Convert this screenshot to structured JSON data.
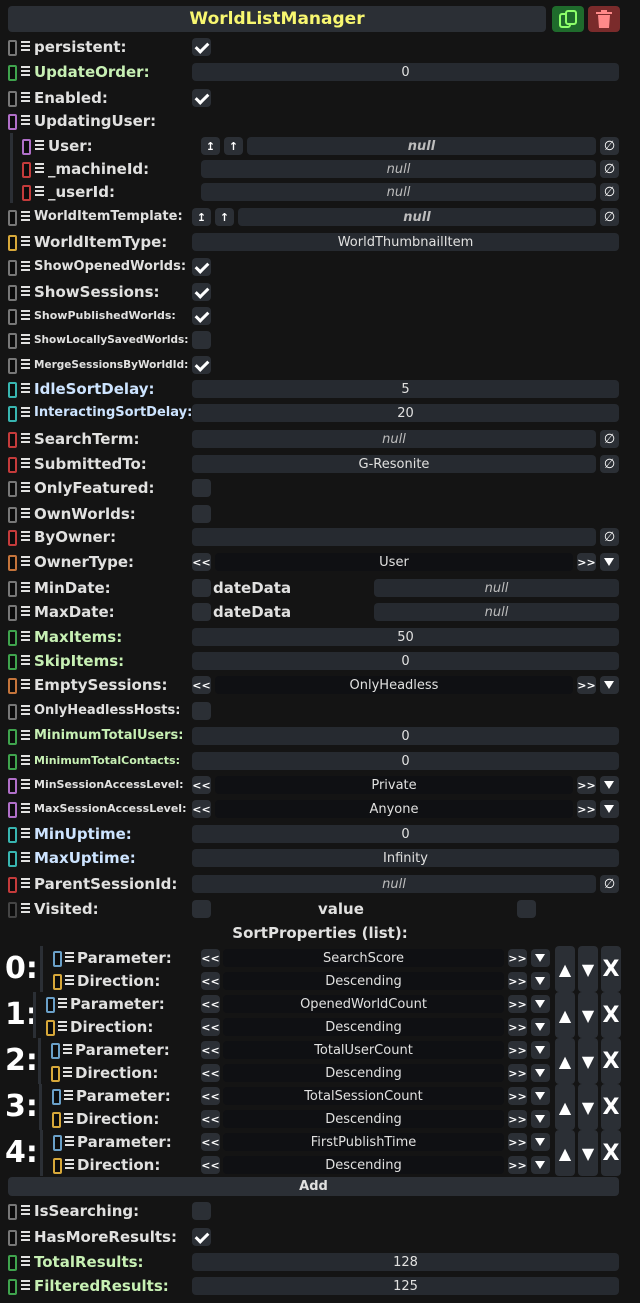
{
  "header": {
    "title": "WorldListManager"
  },
  "fields": {
    "persistent": {
      "label": "persistent:",
      "checked": true
    },
    "update_order": {
      "label": "UpdateOrder:",
      "value": "0"
    },
    "enabled": {
      "label": "Enabled:",
      "checked": true
    },
    "updating_user": {
      "label": "UpdatingUser:"
    },
    "user": {
      "label": "User:",
      "value": "null"
    },
    "machine_id": {
      "label": "_machineId:",
      "value": "null"
    },
    "user_id": {
      "label": "_userId:",
      "value": "null"
    },
    "world_item_template": {
      "label": "WorldItemTemplate:",
      "value": "null"
    },
    "world_item_type": {
      "label": "WorldItemType:",
      "value": "WorldThumbnailItem"
    },
    "show_opened_worlds": {
      "label": "ShowOpenedWorlds:",
      "checked": true
    },
    "show_sessions": {
      "label": "ShowSessions:",
      "checked": true
    },
    "show_published_worlds": {
      "label": "ShowPublishedWorlds:",
      "checked": true
    },
    "show_locally_saved_worlds": {
      "label": "ShowLocallySavedWorlds:",
      "checked": false
    },
    "merge_sessions_by_world_id": {
      "label": "MergeSessionsByWorldId:",
      "checked": true
    },
    "idle_sort_delay": {
      "label": "IdleSortDelay:",
      "value": "5"
    },
    "interacting_sort_delay": {
      "label": "InteractingSortDelay:",
      "value": "20"
    },
    "search_term": {
      "label": "SearchTerm:",
      "value": "null"
    },
    "submitted_to": {
      "label": "SubmittedTo:",
      "value": "G-Resonite"
    },
    "only_featured": {
      "label": "OnlyFeatured:",
      "checked": false
    },
    "own_worlds": {
      "label": "OwnWorlds:",
      "checked": false
    },
    "by_owner": {
      "label": "ByOwner:",
      "value": ""
    },
    "owner_type": {
      "label": "OwnerType:",
      "value": "User"
    },
    "min_date": {
      "label": "MinDate:",
      "sub": "dateData",
      "value": "null"
    },
    "max_date": {
      "label": "MaxDate:",
      "sub": "dateData",
      "value": "null"
    },
    "max_items": {
      "label": "MaxItems:",
      "value": "50"
    },
    "skip_items": {
      "label": "SkipItems:",
      "value": "0"
    },
    "empty_sessions": {
      "label": "EmptySessions:",
      "value": "OnlyHeadless"
    },
    "only_headless_hosts": {
      "label": "OnlyHeadlessHosts:",
      "checked": false
    },
    "minimum_total_users": {
      "label": "MinimumTotalUsers:",
      "value": "0"
    },
    "minimum_total_contacts": {
      "label": "MinimumTotalContacts:",
      "value": "0"
    },
    "min_session_access_level": {
      "label": "MinSessionAccessLevel:",
      "value": "Private"
    },
    "max_session_access_level": {
      "label": "MaxSessionAccessLevel:",
      "value": "Anyone"
    },
    "min_uptime": {
      "label": "MinUptime:",
      "value": "0"
    },
    "max_uptime": {
      "label": "MaxUptime:",
      "value": "Infinity"
    },
    "parent_session_id": {
      "label": "ParentSessionId:",
      "value": "null"
    },
    "visited": {
      "label": "Visited:",
      "sub": "value",
      "checked": false
    }
  },
  "sort_properties": {
    "title": "SortProperties (list):",
    "param_label": "Parameter:",
    "dir_label": "Direction:",
    "items": [
      {
        "index": "0:",
        "parameter": "SearchScore",
        "direction": "Descending"
      },
      {
        "index": "1:",
        "parameter": "OpenedWorldCount",
        "direction": "Descending"
      },
      {
        "index": "2:",
        "parameter": "TotalUserCount",
        "direction": "Descending"
      },
      {
        "index": "3:",
        "parameter": "TotalSessionCount",
        "direction": "Descending"
      },
      {
        "index": "4:",
        "parameter": "FirstPublishTime",
        "direction": "Descending"
      }
    ],
    "add_label": "Add"
  },
  "results": {
    "is_searching": {
      "label": "IsSearching:",
      "checked": false
    },
    "has_more_results": {
      "label": "HasMoreResults:",
      "checked": true
    },
    "total_results": {
      "label": "TotalResults:",
      "value": "128"
    },
    "filtered_results": {
      "label": "FilteredResults:",
      "value": "125"
    }
  },
  "glyphs": {
    "prev": "<<",
    "next": ">>",
    "null_btn": "∅",
    "ref_up": "↥",
    "up": "↑",
    "move_up": "▲",
    "move_down": "▼",
    "remove": "X"
  },
  "colors": {
    "title": "#f8f770",
    "background": "#141414",
    "field": "#262a30",
    "dup_button": "#1f6b2c",
    "delete_button": "#7a2b2b"
  },
  "icons": {
    "duplicate": "duplicate-icon",
    "delete": "trash-icon"
  }
}
